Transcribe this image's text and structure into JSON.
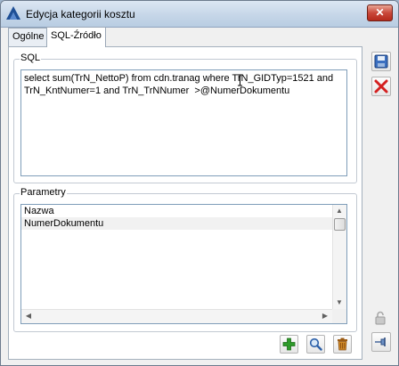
{
  "window": {
    "title": "Edycja kategorii kosztu",
    "close_symbol": "✕"
  },
  "tabs": [
    {
      "label": "Ogólne",
      "active": false
    },
    {
      "label": "SQL-Źródło",
      "active": true
    }
  ],
  "sql_group": {
    "label": "SQL",
    "query": "select sum(TrN_NettoP) from cdn.tranag where TrN_GIDTyp=1521 and TrN_KntNumer=1 and TrN_TrNNumer  >@NumerDokumentu"
  },
  "params_group": {
    "label": "Parametry",
    "column_header": "Nazwa",
    "rows": [
      "NumerDokumentu"
    ]
  },
  "icons": {
    "app": "app-logo-icon",
    "save": "save-icon",
    "cancel": "cancel-icon",
    "add": "add-icon",
    "search": "search-icon",
    "delete": "trash-icon",
    "lock": "lock-icon",
    "pin": "pin-icon"
  },
  "colors": {
    "accent_blue": "#2b5fa8",
    "add_green": "#2e9b2a",
    "cancel_red": "#d42020"
  }
}
